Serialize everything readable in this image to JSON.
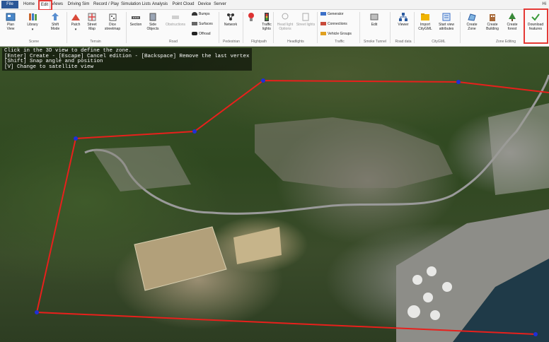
{
  "menu": {
    "tabs": [
      "File",
      "Home",
      "Edit",
      "Views",
      "Driving Sim",
      "Record / Play",
      "Simulation Lists",
      "Analysis",
      "Point Cloud",
      "Device",
      "Server"
    ],
    "active_tab": "Edit",
    "help": "Hi"
  },
  "ribbon": {
    "plan_view": "Plan\nView",
    "library": "Library",
    "shift_mode": "Shift\nMode",
    "patch": "Patch",
    "street_map": "Street\nMap",
    "dice_streetmap": "Dice\nstreetmap",
    "section": "Section",
    "side_objects": "Side\nObjects",
    "obstructions": "Obstructions",
    "bumps": "Bumps",
    "surfaces": "Surfaces",
    "offroad": "Offroad",
    "network": "Network",
    "traffic_lights": "Traffic\nlights",
    "head_light_options": "Head light\nOptions",
    "street_lights": "Street lights",
    "generator": "Generator",
    "connections": "Connections",
    "vehicle_groups": "Vehicle Groups",
    "edit": "Edit",
    "viewer": "Viewer",
    "import_citygml": "Import\nCityGML",
    "start_view_attributes": "Start view\nattributes",
    "create_zone": "Create\nZone",
    "create_building": "Create\nBuilding",
    "create_forest": "Create\nforest",
    "download_features": "Download\nfeatures"
  },
  "groups": {
    "scene": "Scene",
    "terrain": "Terrain",
    "road": "Road",
    "pedestrian": "Pedestrian",
    "flightpath": "Flightpath",
    "headlights": "Headlights",
    "traffic": "Traffic",
    "smoke_tunnel": "Smoke Tunnel",
    "road_data": "Road data",
    "citygml": "CityGML",
    "zone_editing": "Zone Editing"
  },
  "instructions": [
    "Click in the 3D view to define the zone.",
    "[Enter] Create - [Escape] Cancel edition - [Backspace] Remove the last vertex",
    "[Shift] Snap angle and position",
    "[V] Change to satellite view"
  ],
  "colors": {
    "zone_line": "#e8201c",
    "vertex": "#1f2fd6",
    "highlight": "#e53935",
    "file_tab": "#2b5797"
  },
  "icons": [
    "plan-view-icon",
    "library-icon",
    "shift-mode-icon",
    "patch-icon",
    "street-map-icon",
    "dice-icon",
    "section-icon",
    "side-objects-icon",
    "obstructions-icon",
    "bumps-icon",
    "surfaces-icon",
    "offroad-icon",
    "network-icon",
    "traffic-lights-icon",
    "head-light-icon",
    "street-lights-icon",
    "generator-icon",
    "connections-icon",
    "vehicle-groups-icon",
    "edit-icon",
    "viewer-icon",
    "import-citygml-icon",
    "start-view-icon",
    "create-zone-icon",
    "create-building-icon",
    "create-forest-icon",
    "download-features-icon"
  ]
}
